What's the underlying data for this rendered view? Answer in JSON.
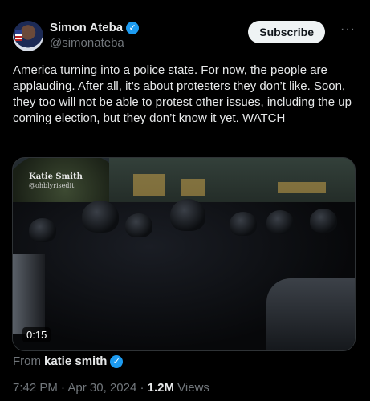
{
  "author": {
    "display_name": "Simon Ateba",
    "handle": "@simonateba",
    "verified_icon": "check-badge-icon"
  },
  "subscribe_label": "Subscribe",
  "more_label": "···",
  "tweet_text": "America turning into a police state. For now, the people are applauding. After all, it’s about protesters they don’t like. Soon, they too will not be able to protest other issues, including the up coming election, but they don’t know it yet. WATCH",
  "media": {
    "watermark_name": "Katie Smith",
    "watermark_handle": "@ohblyrisedit",
    "duration": "0:15"
  },
  "attribution": {
    "prefix": "From",
    "source_name": "katie smith"
  },
  "meta": {
    "time": "7:42 PM",
    "separator": "·",
    "date": "Apr 30, 2024",
    "views_count": "1.2M",
    "views_label": "Views"
  },
  "colors": {
    "background": "#000000",
    "text": "#e7e9ea",
    "muted": "#71767b",
    "verified": "#1d9bf0",
    "button": "#eff3f4"
  }
}
